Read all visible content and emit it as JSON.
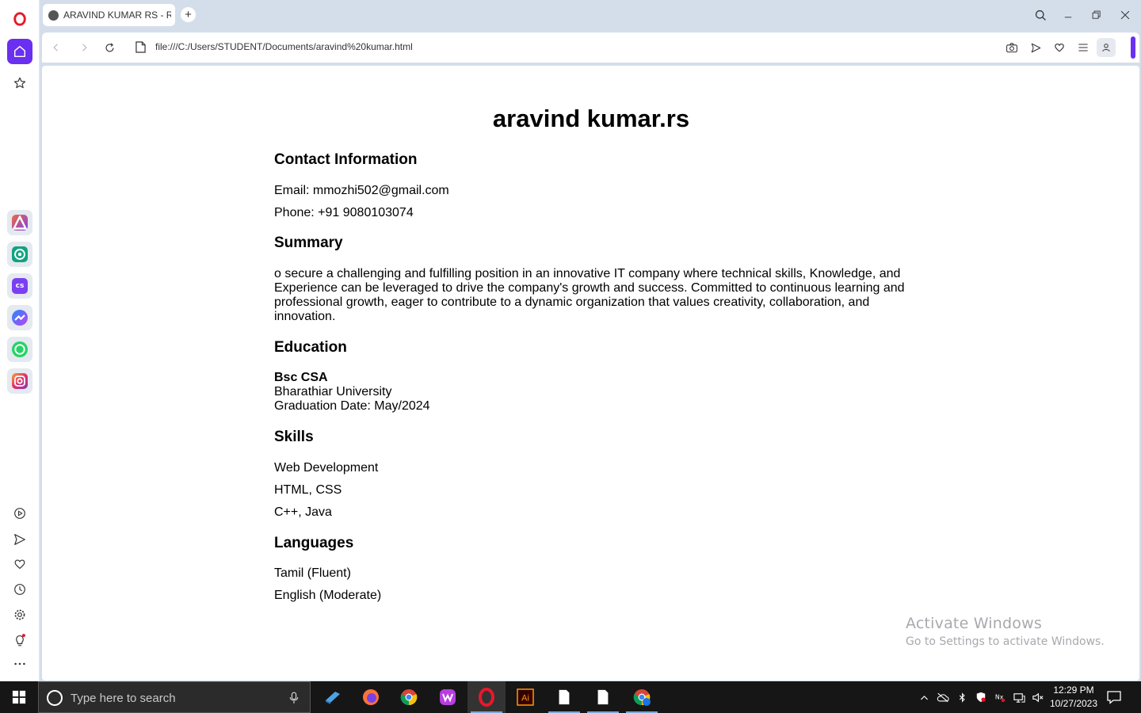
{
  "browser": {
    "tab_title": "ARAVIND KUMAR RS - Re",
    "new_tab_label": "+",
    "url": "file:///C:/Users/STUDENT/Documents/aravind%20kumar.html"
  },
  "sidebar": {
    "apps": [
      {
        "name": "aria",
        "color": "#f26b3a"
      },
      {
        "name": "chatgpt",
        "color": "#10a37f"
      },
      {
        "name": "chatsonic",
        "color": "#7b3ff2",
        "text": "cs"
      },
      {
        "name": "messenger",
        "color": "#1f8cff"
      },
      {
        "name": "whatsapp",
        "color": "#25d366"
      },
      {
        "name": "instagram",
        "color": "#e1306c"
      }
    ]
  },
  "resume": {
    "name": "aravind kumar.rs",
    "contact_heading": "Contact Information",
    "email": "Email: mmozhi502@gmail.com",
    "phone": "Phone: +91 9080103074",
    "summary_heading": "Summary",
    "summary_text": "o secure a challenging and fulfilling position in an innovative IT company where technical skills, Knowledge, and Experience can be leveraged to drive the company's growth and success. Committed to continuous learning and professional growth, eager to contribute to a dynamic organization that values creativity, collaboration, and innovation.",
    "education_heading": "Education",
    "degree": "Bsc CSA",
    "university": "Bharathiar University",
    "graduation": "Graduation Date: May/2024",
    "skills_heading": "Skills",
    "skills": [
      "Web Development",
      "HTML, CSS",
      "C++, Java"
    ],
    "languages_heading": "Languages",
    "languages": [
      "Tamil (Fluent)",
      "English (Moderate)"
    ]
  },
  "watermark": {
    "line1": "Activate Windows",
    "line2": "Go to Settings to activate Windows."
  },
  "taskbar": {
    "search_placeholder": "Type here to search",
    "time": "12:29 PM",
    "date": "10/27/2023"
  },
  "colors": {
    "opera_red": "#e8182c",
    "opera_purple": "#6a2ff0",
    "page_bg": "#d4deeb"
  }
}
